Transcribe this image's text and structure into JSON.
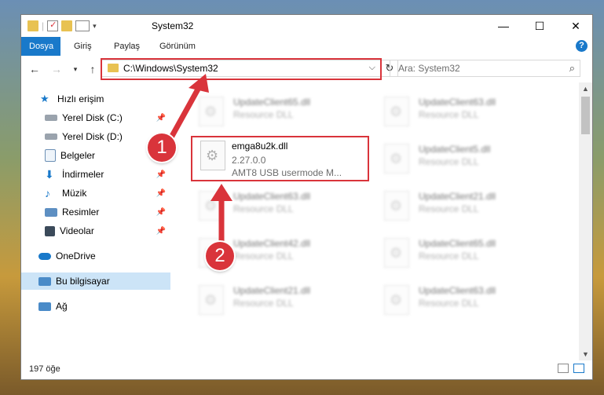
{
  "window": {
    "title": "System32",
    "controls": {
      "minimize": "—",
      "maximize": "☐",
      "close": "✕"
    }
  },
  "ribbon": {
    "tabs": [
      "Dosya",
      "Giriş",
      "Paylaş",
      "Görünüm"
    ],
    "active_tab": "Dosya",
    "help": "?"
  },
  "address": {
    "path": "C:\\Windows\\System32",
    "search_placeholder": "Ara: System32"
  },
  "nav": {
    "items": [
      {
        "label": "Hızlı erişim",
        "pinned": false
      },
      {
        "label": "Yerel Disk (C:)",
        "pinned": true
      },
      {
        "label": "Yerel Disk (D:)",
        "pinned": false
      },
      {
        "label": "Belgeler",
        "pinned": true
      },
      {
        "label": "İndirmeler",
        "pinned": true
      },
      {
        "label": "Müzik",
        "pinned": true
      },
      {
        "label": "Resimler",
        "pinned": true
      },
      {
        "label": "Videolar",
        "pinned": true
      },
      {
        "label": "OneDrive",
        "pinned": false
      },
      {
        "label": "Bu bilgisayar",
        "pinned": false,
        "selected": true
      },
      {
        "label": "Ağ",
        "pinned": false
      }
    ]
  },
  "files": {
    "highlighted": {
      "name": "emga8u2k.dll",
      "version": "2.27.0.0",
      "description": "AMT8 USB usermode M..."
    },
    "background": [
      {
        "name": "UpdateClient65.dll",
        "type": "Resource DLL"
      },
      {
        "name": "UpdateClient63.dll",
        "type": "Resource DLL"
      },
      {
        "name": "UpdateClient5.dll",
        "type": "Resource DLL"
      },
      {
        "name": "UpdateClient63.dll",
        "type": "Resource DLL"
      },
      {
        "name": "UpdateClient21.dll",
        "type": "Resource DLL"
      },
      {
        "name": "UpdateClient42.dll",
        "type": "Resource DLL"
      },
      {
        "name": "UpdateClient65.dll",
        "type": "Resource DLL"
      },
      {
        "name": "UpdateClient21.dll",
        "type": "Resource DLL"
      },
      {
        "name": "UpdateClient63.dll",
        "type": "Resource DLL"
      }
    ]
  },
  "status": {
    "count": "197 öğe"
  },
  "annotations": {
    "step1": "1",
    "step2": "2",
    "color": "#d9343b"
  }
}
